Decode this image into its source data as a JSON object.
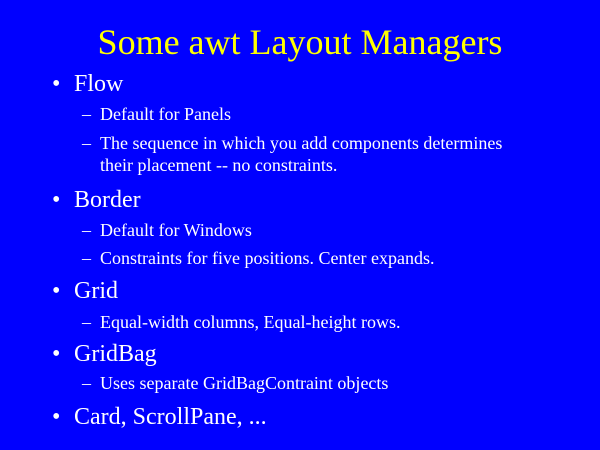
{
  "slide": {
    "title": "Some awt Layout Managers",
    "bullet_glyph": "•",
    "dash_glyph": "–",
    "items": [
      {
        "label": "Flow",
        "subitems": [
          {
            "text": "Default for Panels"
          },
          {
            "text": "The sequence in which you add components determines",
            "continuation": "their placement -- no constraints."
          }
        ]
      },
      {
        "label": "Border",
        "subitems": [
          {
            "text": "Default for Windows"
          },
          {
            "text": "Constraints for five positions.  Center expands."
          }
        ]
      },
      {
        "label": "Grid",
        "subitems": [
          {
            "text": "Equal-width columns, Equal-height rows."
          }
        ]
      },
      {
        "label": "GridBag",
        "subitems": [
          {
            "text": "Uses separate GridBagContraint objects"
          }
        ]
      },
      {
        "label": "Card, ScrollPane, ..."
      }
    ]
  },
  "colors": {
    "background": "#0000ff",
    "title": "#ffff00",
    "text": "#ffffff"
  }
}
